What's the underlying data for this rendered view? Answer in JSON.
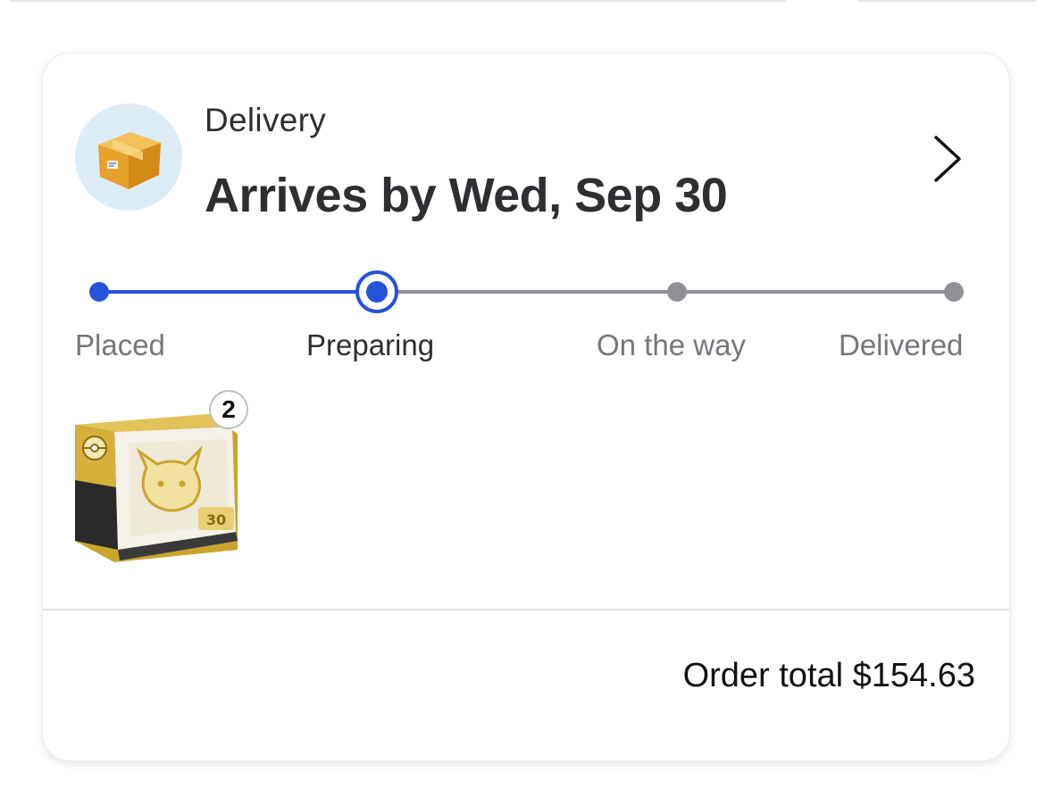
{
  "delivery_card": {
    "type_label": "Delivery",
    "arrival_text": "Arrives by Wed, Sep 30",
    "status_icon": "package-box-icon",
    "open_icon": "chevron-right-icon"
  },
  "tracker": {
    "current_step": 1,
    "steps": [
      {
        "label": "Placed",
        "state": "complete"
      },
      {
        "label": "Preparing",
        "state": "current"
      },
      {
        "label": "On the way",
        "state": "upcoming"
      },
      {
        "label": "Delivered",
        "state": "upcoming"
      }
    ],
    "colors": {
      "complete": "#2654d9",
      "upcoming": "#909196"
    }
  },
  "items": [
    {
      "name": "pokemon-elite-trainer-box",
      "quantity": "2"
    }
  ],
  "order": {
    "total_label": "Order total $154.63"
  }
}
